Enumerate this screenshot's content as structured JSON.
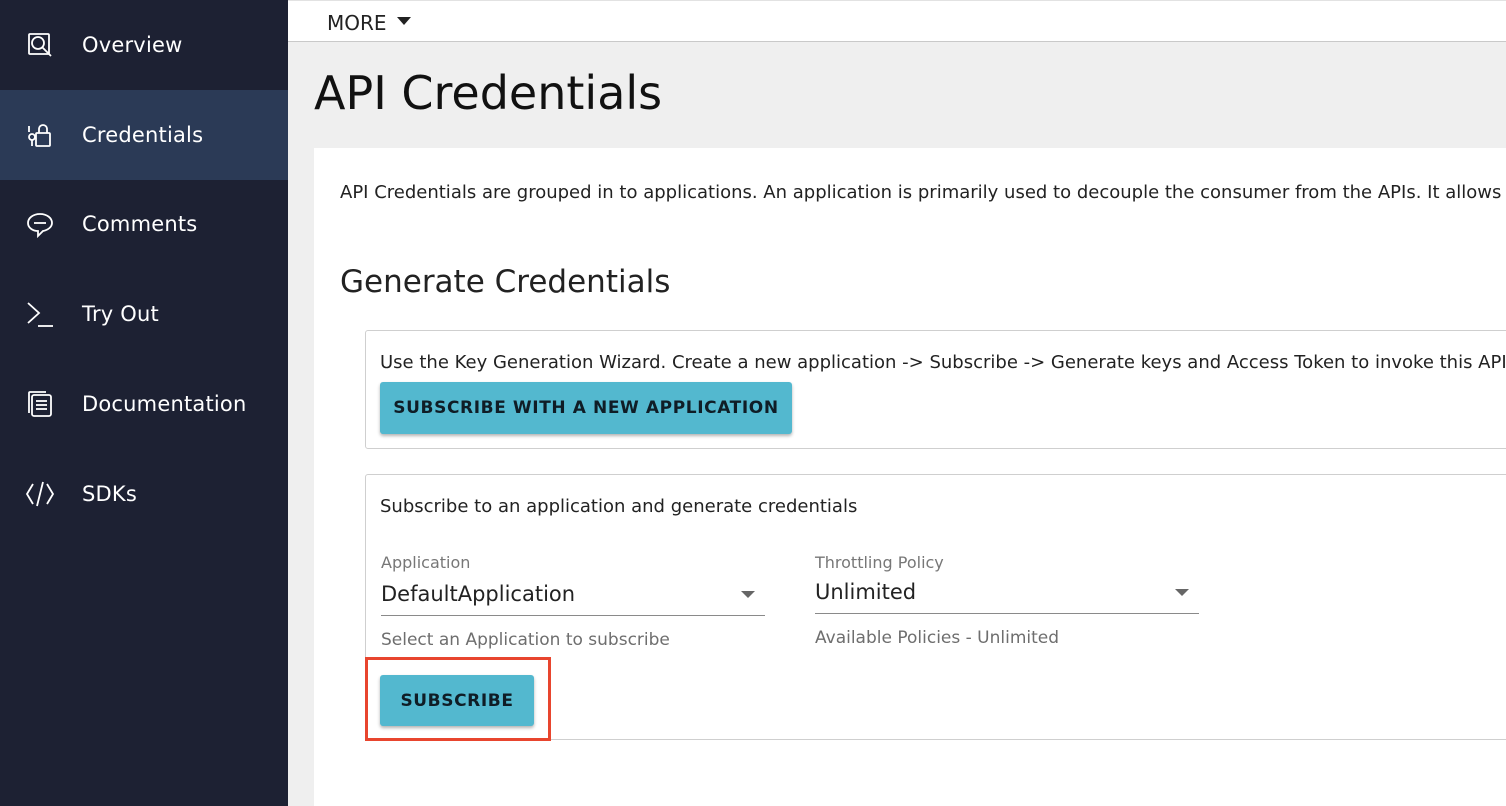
{
  "sidebar": {
    "items": [
      {
        "label": "Overview",
        "icon": "search-document-icon",
        "active": false
      },
      {
        "label": "Credentials",
        "icon": "credentials-lock-icon",
        "active": true
      },
      {
        "label": "Comments",
        "icon": "comment-bubble-icon",
        "active": false
      },
      {
        "label": "Try Out",
        "icon": "terminal-prompt-icon",
        "active": false
      },
      {
        "label": "Documentation",
        "icon": "document-stack-icon",
        "active": false
      },
      {
        "label": "SDKs",
        "icon": "code-brackets-icon",
        "active": false
      }
    ]
  },
  "topbar": {
    "more_label": "MORE"
  },
  "page": {
    "title": "API Credentials",
    "intro": "API Credentials are grouped in to applications. An application is primarily used to decouple the consumer from the APIs. It allows yo",
    "section_title": "Generate Credentials"
  },
  "wizard": {
    "text": "Use the Key Generation Wizard. Create a new application -> Subscribe -> Generate keys and Access Token to invoke this API.",
    "button_label": "SUBSCRIBE WITH A NEW APPLICATION"
  },
  "subscribe": {
    "heading": "Subscribe to an application and generate credentials",
    "application": {
      "label": "Application",
      "value": "DefaultApplication",
      "helper": "Select an Application to subscribe"
    },
    "throttling": {
      "label": "Throttling Policy",
      "value": "Unlimited",
      "helper": "Available Policies - Unlimited"
    },
    "button_label": "SUBSCRIBE"
  },
  "colors": {
    "sidebar_bg": "#1d2133",
    "sidebar_active": "#2b3a56",
    "button": "#53b8cf",
    "highlight": "#e8452e"
  }
}
